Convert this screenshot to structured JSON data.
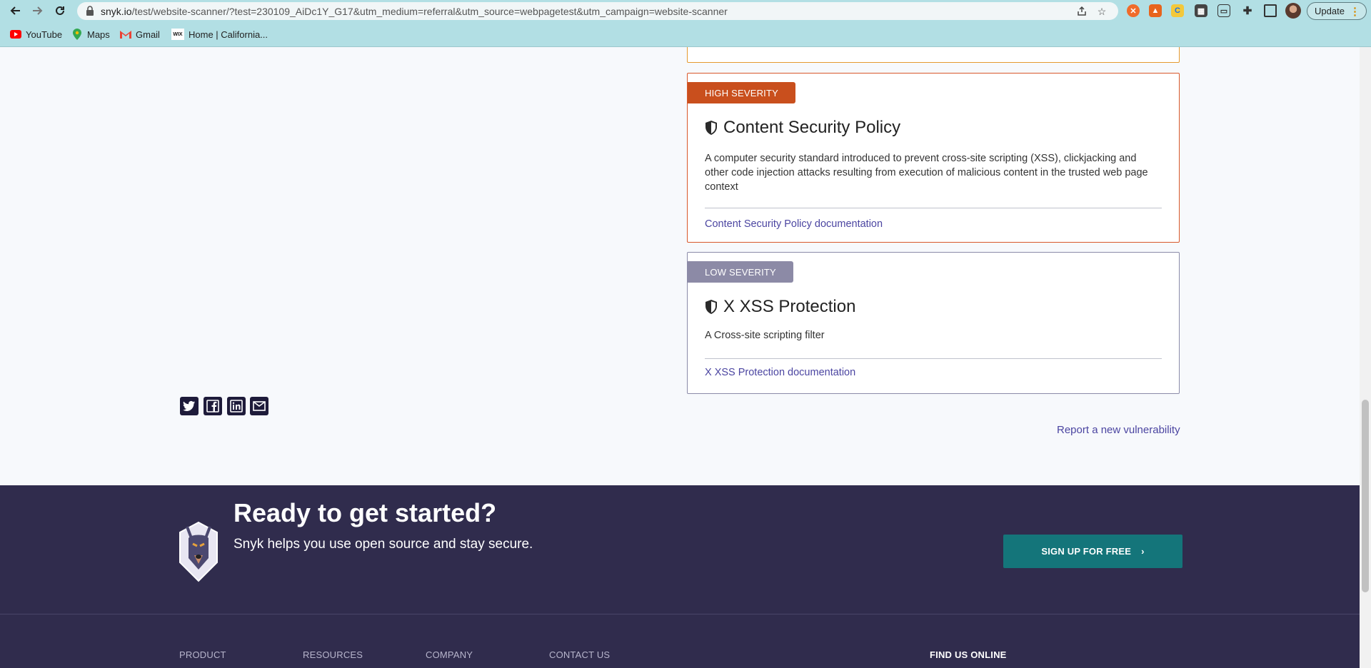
{
  "browser": {
    "url_host": "snyk.io",
    "url_path": "/test/website-scanner/?test=230109_AiDc1Y_G17&utm_medium=referral&utm_source=webpagetest&utm_campaign=website-scanner",
    "update_label": "Update"
  },
  "bookmarks": [
    {
      "label": "YouTube",
      "icon": "youtube-icon"
    },
    {
      "label": "Maps",
      "icon": "maps-icon"
    },
    {
      "label": "Gmail",
      "icon": "gmail-icon"
    },
    {
      "label": "Home | California...",
      "icon": "wix-icon"
    }
  ],
  "findings": {
    "high": {
      "severity": "HIGH SEVERITY",
      "title": "Content Security Policy",
      "description": "A computer security standard introduced to prevent cross-site scripting (XSS), clickjacking and other code injection attacks resulting from execution of malicious content in the trusted web page context",
      "link": "Content Security Policy documentation"
    },
    "low": {
      "severity": "LOW SEVERITY",
      "title": "X XSS Protection",
      "description": "A Cross-site scripting filter",
      "link": "X XSS Protection documentation"
    }
  },
  "share": {
    "report_link": "Report a new vulnerability"
  },
  "cta": {
    "title": "Ready to get started?",
    "subtitle": "Snyk helps you use open source and stay secure.",
    "button": "SIGN UP FOR FREE"
  },
  "footer": {
    "product": "PRODUCT",
    "resources": "RESOURCES",
    "company": "COMPANY",
    "contact": "CONTACT US",
    "find_us": "FIND US ONLINE"
  },
  "colors": {
    "high": "#c94f1d",
    "medium": "#e59a2f",
    "low": "#8c8aa6",
    "cta_bg": "#302c4d",
    "signup": "#14757a",
    "link": "#4b45a1"
  }
}
